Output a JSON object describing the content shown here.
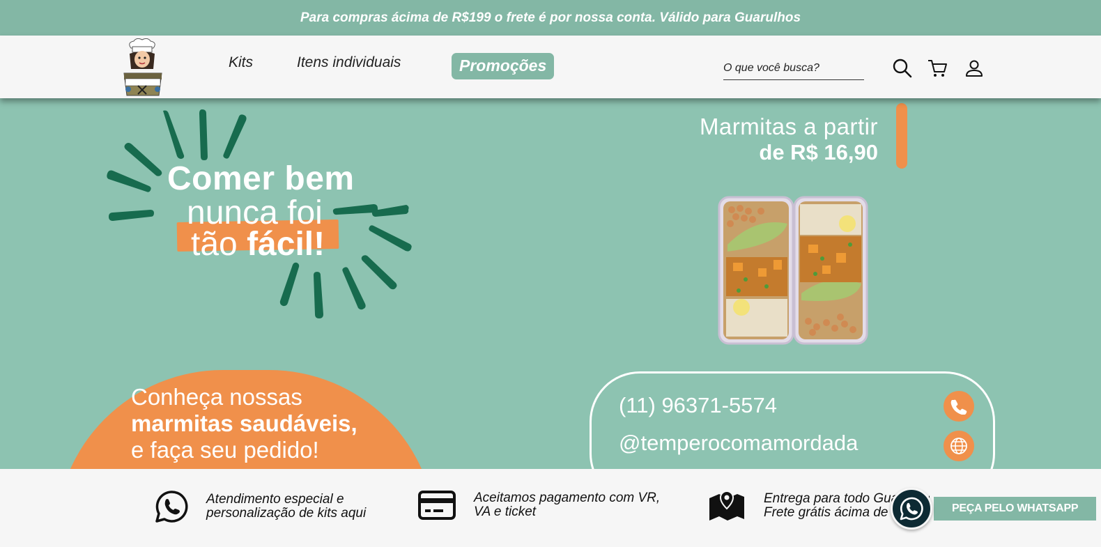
{
  "announcement": "Para compras ácima de R$199 o frete é por nossa conta. Válido para Guarulhos",
  "header": {
    "logo_alt": "Tempero com Amor",
    "nav": {
      "kits": "Kits",
      "itens": "Itens individuais",
      "promocoes": "Promoções"
    },
    "search_placeholder": "O que você busca?",
    "icons": [
      "search-icon",
      "cart-icon",
      "user-icon"
    ]
  },
  "hero": {
    "headline_line1": "Comer bem",
    "headline_line2": "nunca foi",
    "headline_line3_prefix": "tão ",
    "headline_line3_bold": "fácil!",
    "price_line1": "Marmitas a partir",
    "price_line2": "de R$ 16,90",
    "blob_line1": "Conheça nossas",
    "blob_line2": "marmitas saudáveis",
    "blob_line2_suffix": ",",
    "blob_line3": "e faça seu pedido!",
    "phone": "(11) 96371-5574",
    "instagram": "@temperocomamordada"
  },
  "features": [
    {
      "icon": "whatsapp-icon",
      "text": "Atendimento especial e\npersonalização de kits aqui"
    },
    {
      "icon": "credit-card-icon",
      "text": "Aceitamos pagamento com VR,\nVA e ticket"
    },
    {
      "icon": "map-icon",
      "text": "Entrega para todo Guarulhos\nFrete grátis ácima de R$199"
    }
  ],
  "whatsapp_button": "PEÇA PELO WHATSAPP",
  "colors": {
    "teal": "#8dc3b1",
    "teal_dark": "#83b7a5",
    "orange": "#f0904b",
    "dark_green": "#176b4e"
  }
}
